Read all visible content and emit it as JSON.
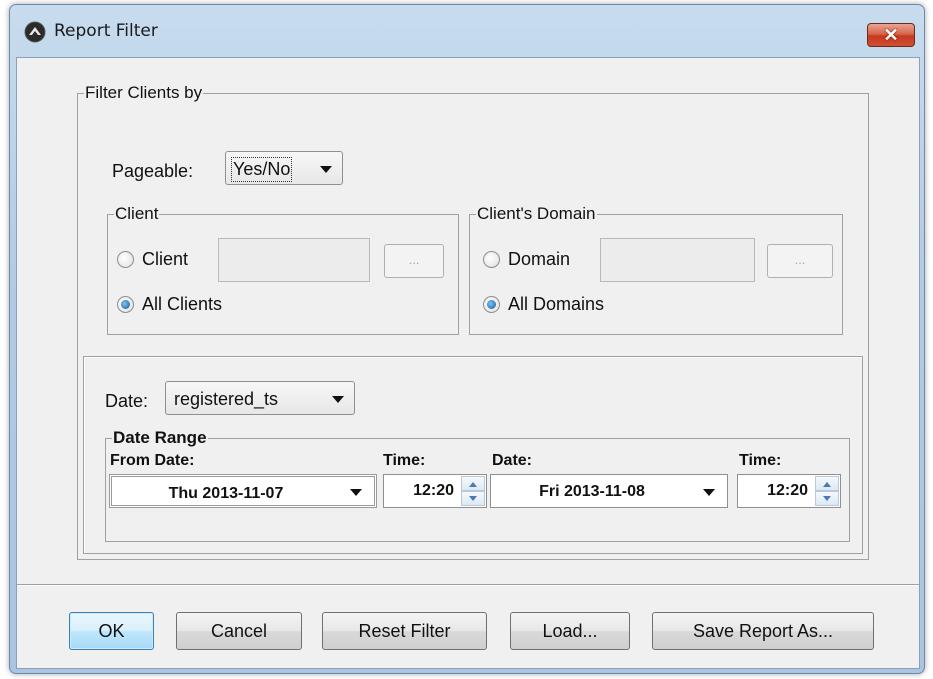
{
  "window": {
    "title": "Report Filter",
    "close_label": "✕",
    "app_icon": "app-logo-icon"
  },
  "filter_group": {
    "legend": "Filter Clients by",
    "pageable_label": "Pageable:",
    "pageable_value": "Yes/No"
  },
  "client_group": {
    "legend": "Client",
    "client_radio_label": "Client",
    "all_clients_label": "All Clients",
    "client_field_value": "",
    "browse_label": "...",
    "selected": "All Clients"
  },
  "domain_group": {
    "legend": "Client's Domain",
    "domain_radio_label": "Domain",
    "all_domains_label": "All Domains",
    "domain_field_value": "",
    "browse_label": "...",
    "selected": "All Domains"
  },
  "date_group": {
    "date_label": "Date:",
    "date_field_value": "registered_ts"
  },
  "date_range": {
    "legend": "Date Range",
    "from_date_label": "From Date:",
    "from_time_label": "Time:",
    "to_date_label": "Date:",
    "to_time_label": "Time:",
    "from_date_value": "Thu 2013-11-07",
    "from_time_value": "12:20",
    "to_date_value": "Fri 2013-11-08",
    "to_time_value": "12:20"
  },
  "buttons": {
    "ok": "OK",
    "cancel": "Cancel",
    "reset": "Reset Filter",
    "load": "Load...",
    "save": "Save Report As..."
  }
}
